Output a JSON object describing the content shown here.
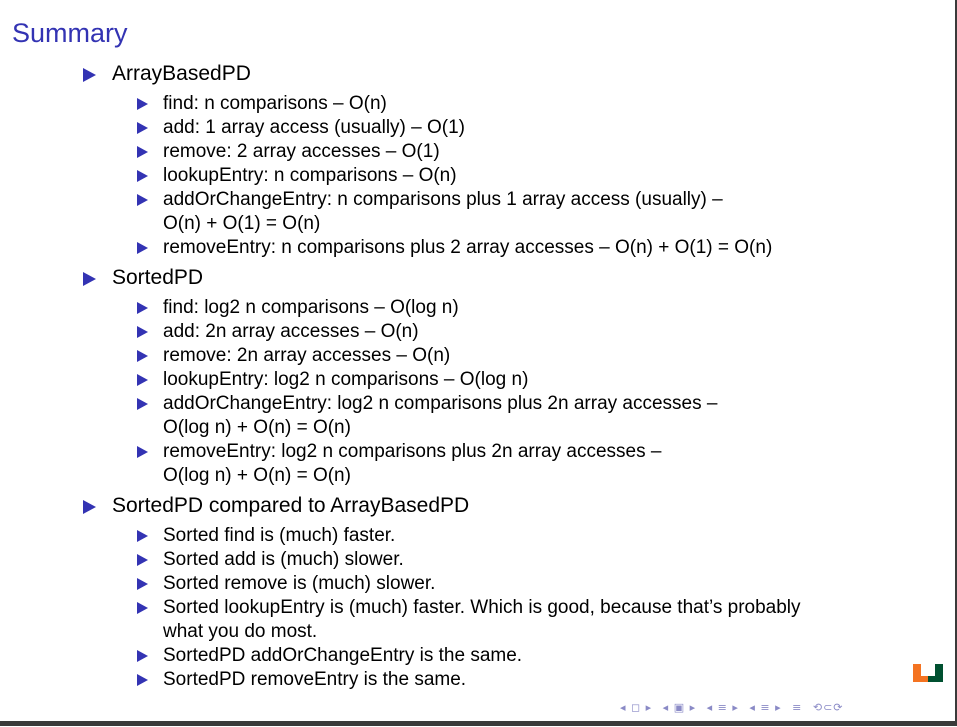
{
  "slide": {
    "title": "Summary"
  },
  "sections": [
    {
      "heading": "ArrayBasedPD",
      "items": [
        "find: n comparisons – O(n)",
        "add: 1 array access (usually) – O(1)",
        "remove: 2 array accesses – O(1)",
        "lookupEntry: n comparisons – O(n)",
        "addOrChangeEntry: n comparisons plus 1 array access (usually) –",
        "O(n) + O(1) = O(n)",
        "removeEntry: n comparisons plus 2 array accesses – O(n) + O(1) = O(n)"
      ]
    },
    {
      "heading": "SortedPD",
      "items": [
        "find: log2 n comparisons – O(log n)",
        "add: 2n array accesses – O(n)",
        "remove: 2n array accesses – O(n)",
        "lookupEntry: log2 n comparisons – O(log n)",
        "addOrChangeEntry: log2 n comparisons plus 2n array accesses –",
        "O(log n) + O(n) = O(n)",
        "removeEntry: log2 n comparisons plus 2n array accesses –",
        "O(log n) + O(n) = O(n)"
      ]
    },
    {
      "heading": "SortedPD compared to ArrayBasedPD",
      "items": [
        "Sorted find is (much) faster.",
        "Sorted add is (much) slower.",
        "Sorted remove is (much) slower.",
        "Sorted lookupEntry is (much) faster. Which is good, because that’s probably",
        "what you do most.",
        "SortedPD addOrChangeEntry is the same.",
        "SortedPD removeEntry is the same."
      ]
    }
  ],
  "colors": {
    "title": "#3333b3",
    "bullet": "#3333b3",
    "logo_orange": "#f47321",
    "logo_green": "#005030"
  },
  "nav_icons": [
    "first-frame-icon",
    "prev-frame-icon",
    "prev-section-icon",
    "next-section-icon",
    "search-icon",
    "zoom-icon"
  ]
}
